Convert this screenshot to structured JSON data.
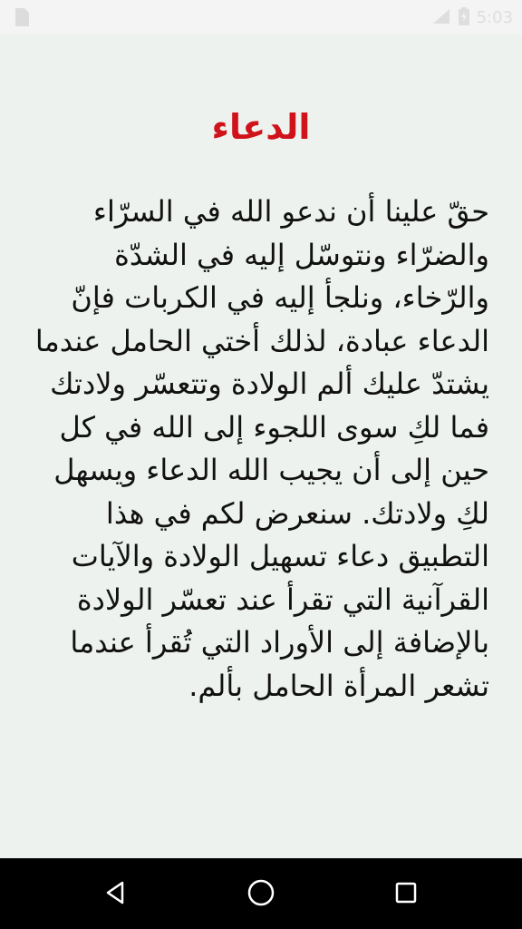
{
  "status_bar": {
    "time": "5:03",
    "left_icon": "image-notification-icon",
    "right_icons": [
      "signal-icon",
      "battery-charging-icon"
    ]
  },
  "main": {
    "title": "الدعاء",
    "body": "حقّ علينا أن ندعو الله في السرّاء والضرّاء ونتوسّل إليه في الشدّة والرّخاء، ونلجأ إليه في الكربات فإنّ الدعاء عبادة، لذلك أختي الحامل عندما يشتدّ عليك ألم الولادة وتتعسّر ولادتك فما لكِ سوى اللجوء إلى الله في كل حين إلى أن يجيب الله الدعاء ويسهل لكِ ولادتك. سنعرض لكم في هذا التطبيق دعاء تسهيل الولادة والآيات القرآنية التي تقرأ عند تعسّر الولادة بالإضافة إلى الأوراد التي تُقرأ عندما تشعر المرأة الحامل بألم."
  },
  "nav_bar": {
    "buttons": [
      "back-icon",
      "home-icon",
      "recents-icon"
    ]
  },
  "colors": {
    "title": "#d0121b",
    "background": "#eef2ee",
    "nav_bar": "#000000"
  }
}
